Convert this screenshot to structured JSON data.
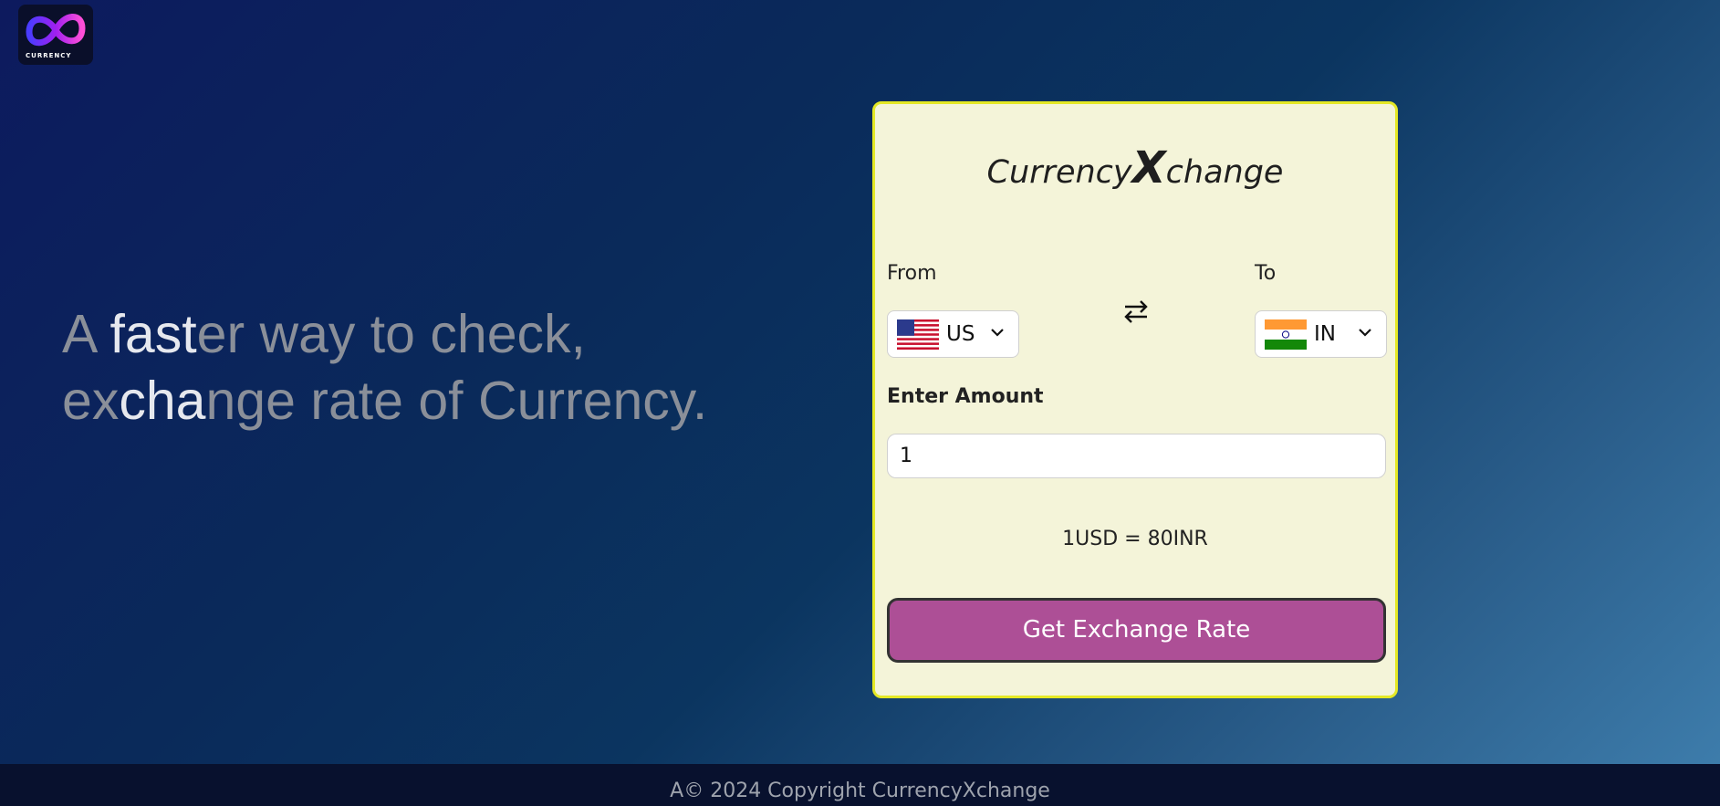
{
  "logo": {
    "text": "CURRENCY"
  },
  "hero": {
    "line1": [
      {
        "t": "A ",
        "hl": false
      },
      {
        "t": "fast",
        "hl": true
      },
      {
        "t": "e",
        "hl": false
      },
      {
        "t": "r way to check,",
        "hl": false
      }
    ],
    "line2": [
      {
        "t": "ex",
        "hl": false
      },
      {
        "t": "cha",
        "hl": true
      },
      {
        "t": "nge rate of Currency.",
        "hl": false
      }
    ]
  },
  "card": {
    "brand_prefix": "Currency",
    "brand_x": "X",
    "brand_suffix": "change",
    "from_label": "From",
    "to_label": "To",
    "from_code": "US",
    "to_code": "IN",
    "amount_label": "Enter Amount",
    "amount_value": "1",
    "rate_text": "1USD = 80INR",
    "button_label": "Get Exchange Rate"
  },
  "footer": {
    "text": "A© 2024 Copyright CurrencyXchange"
  },
  "colors": {
    "card_bg": "#f4f4d9",
    "card_border": "#e4e825",
    "button": "#ad4f96"
  }
}
